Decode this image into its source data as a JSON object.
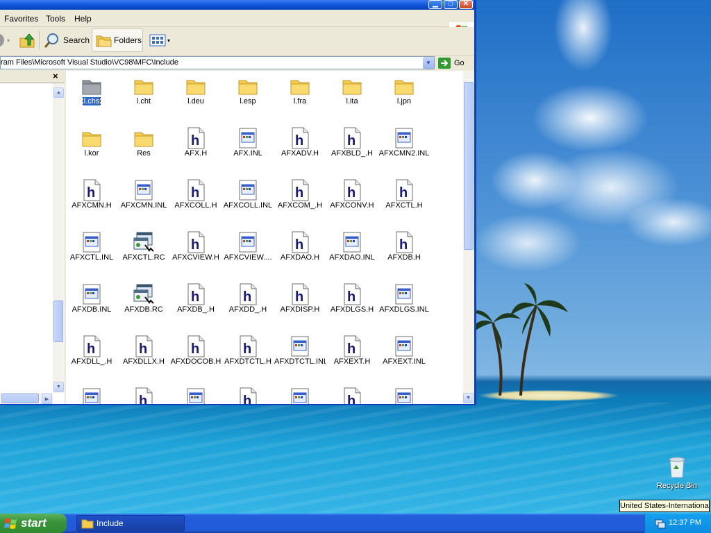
{
  "window": {
    "menu": [
      "Favorites",
      "Tools",
      "Help"
    ],
    "toolbar": {
      "search_label": "Search",
      "folders_label": "Folders"
    },
    "address": {
      "path": "ram Files\\Microsoft Visual Studio\\VC98\\MFC\\Include",
      "go_label": "Go"
    },
    "close_symbol": "×",
    "files": [
      {
        "name": "l.chs",
        "kind": "folder-gray",
        "selected": true
      },
      {
        "name": "l.cht",
        "kind": "folder"
      },
      {
        "name": "l.deu",
        "kind": "folder"
      },
      {
        "name": "l.esp",
        "kind": "folder"
      },
      {
        "name": "l.fra",
        "kind": "folder"
      },
      {
        "name": "l.ita",
        "kind": "folder"
      },
      {
        "name": "l.jpn",
        "kind": "folder"
      },
      {
        "name": "l.kor",
        "kind": "folder"
      },
      {
        "name": "Res",
        "kind": "folder"
      },
      {
        "name": "AFX.H",
        "kind": "h"
      },
      {
        "name": "AFX.INL",
        "kind": "inl"
      },
      {
        "name": "AFXADV.H",
        "kind": "h"
      },
      {
        "name": "AFXBLD_.H",
        "kind": "h"
      },
      {
        "name": "AFXCMN2.INL",
        "kind": "inl"
      },
      {
        "name": "AFXCMN.H",
        "kind": "h"
      },
      {
        "name": "AFXCMN.INL",
        "kind": "inl"
      },
      {
        "name": "AFXCOLL.H",
        "kind": "h"
      },
      {
        "name": "AFXCOLL.INL",
        "kind": "inl"
      },
      {
        "name": "AFXCOM_.H",
        "kind": "h"
      },
      {
        "name": "AFXCONV.H",
        "kind": "h"
      },
      {
        "name": "AFXCTL.H",
        "kind": "h"
      },
      {
        "name": "AFXCTL.INL",
        "kind": "inl"
      },
      {
        "name": "AFXCTL.RC",
        "kind": "rc"
      },
      {
        "name": "AFXCVIEW.H",
        "kind": "h"
      },
      {
        "name": "AFXCVIEW....",
        "kind": "inl"
      },
      {
        "name": "AFXDAO.H",
        "kind": "h"
      },
      {
        "name": "AFXDAO.INL",
        "kind": "inl"
      },
      {
        "name": "AFXDB.H",
        "kind": "h"
      },
      {
        "name": "AFXDB.INL",
        "kind": "inl"
      },
      {
        "name": "AFXDB.RC",
        "kind": "rc"
      },
      {
        "name": "AFXDB_.H",
        "kind": "h"
      },
      {
        "name": "AFXDD_.H",
        "kind": "h"
      },
      {
        "name": "AFXDISP.H",
        "kind": "h"
      },
      {
        "name": "AFXDLGS.H",
        "kind": "h"
      },
      {
        "name": "AFXDLGS.INL",
        "kind": "inl"
      },
      {
        "name": "AFXDLL_.H",
        "kind": "h"
      },
      {
        "name": "AFXDLLX.H",
        "kind": "h"
      },
      {
        "name": "AFXDOCOB.H",
        "kind": "h"
      },
      {
        "name": "AFXDTCTL.H",
        "kind": "h"
      },
      {
        "name": "AFXDTCTL.INL",
        "kind": "inl"
      },
      {
        "name": "AFXEXT.H",
        "kind": "h"
      },
      {
        "name": "AFXEXT.INL",
        "kind": "inl"
      },
      {
        "name": "",
        "kind": "inl"
      },
      {
        "name": "",
        "kind": "h"
      },
      {
        "name": "",
        "kind": "inl"
      },
      {
        "name": "",
        "kind": "h"
      },
      {
        "name": "",
        "kind": "inl"
      },
      {
        "name": "",
        "kind": "h"
      },
      {
        "name": "",
        "kind": "inl"
      }
    ]
  },
  "desktop": {
    "recycle_bin_label": "Recycle Bin",
    "tooltip": "United States-International"
  },
  "taskbar": {
    "start_label": "start",
    "task_label": "Include",
    "clock": "12:37 PM"
  }
}
